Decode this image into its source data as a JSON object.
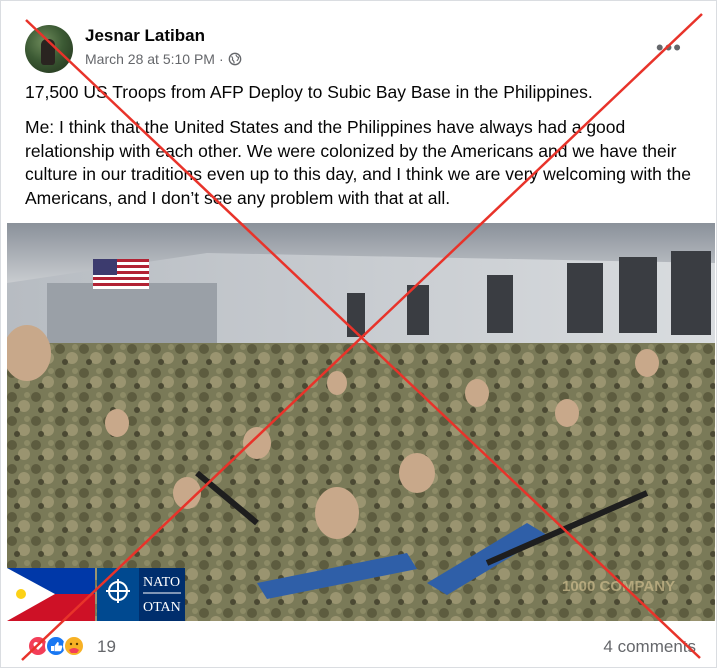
{
  "post": {
    "author": "Jesnar Latiban",
    "timestamp": "March 28 at 5:10 PM",
    "separator": "·",
    "headline": "17,500 US Troops from AFP Deploy to Subic Bay Base in the Philippines.",
    "body": "Me: I think that the United States and the Philippines have always had a good relationship with each other. We were colonized by the Americans and we have their culture in our traditions even up to this day, and I think we are very welcoming with the Americans, and I don’t see any problem with that at all.",
    "more_label": "•••"
  },
  "image": {
    "overlay_nato": "NATO",
    "overlay_otan": "OTAN",
    "watermark": "1000 COMPANY"
  },
  "footer": {
    "reaction_count": "19",
    "comments": "4 comments",
    "reactions": [
      "love-icon",
      "like-icon",
      "care-icon"
    ]
  },
  "colors": {
    "cross": "#e8332a",
    "like_blue": "#1877f2",
    "love_red": "#f33e58",
    "care_yellow": "#f7b125",
    "nato_blue": "#004990"
  }
}
